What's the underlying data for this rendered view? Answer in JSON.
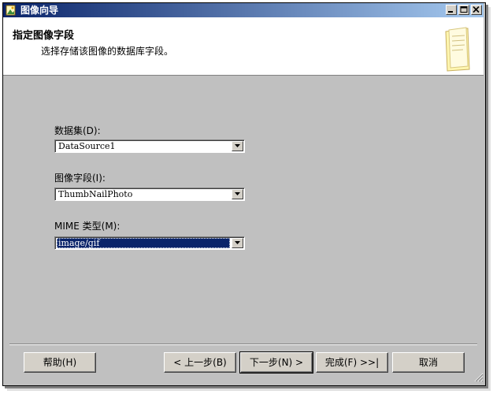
{
  "window": {
    "title": "图像向导",
    "controls": [
      "minimize-icon",
      "maximize-icon",
      "close-icon"
    ]
  },
  "header": {
    "title": "指定图像字段",
    "subtitle": "选择存储该图像的数据库字段。",
    "icon": "wizard-page-icon"
  },
  "fields": {
    "dataset": {
      "label": "数据集(D):",
      "value": "DataSource1"
    },
    "image_field": {
      "label": "图像字段(I):",
      "value": "ThumbNailPhoto"
    },
    "mime_type": {
      "label": "MIME 类型(M):",
      "value": "image/gif"
    }
  },
  "buttons": {
    "help": "帮助(H)",
    "back": "< 上一步(B)",
    "next": "下一步(N) >",
    "finish": "完成(F) >>|",
    "cancel": "取消"
  },
  "colors": {
    "titlebar_start": "#0a246a",
    "titlebar_end": "#a6caf0",
    "selection": "#0a246a",
    "face": "#c0c0c0"
  }
}
